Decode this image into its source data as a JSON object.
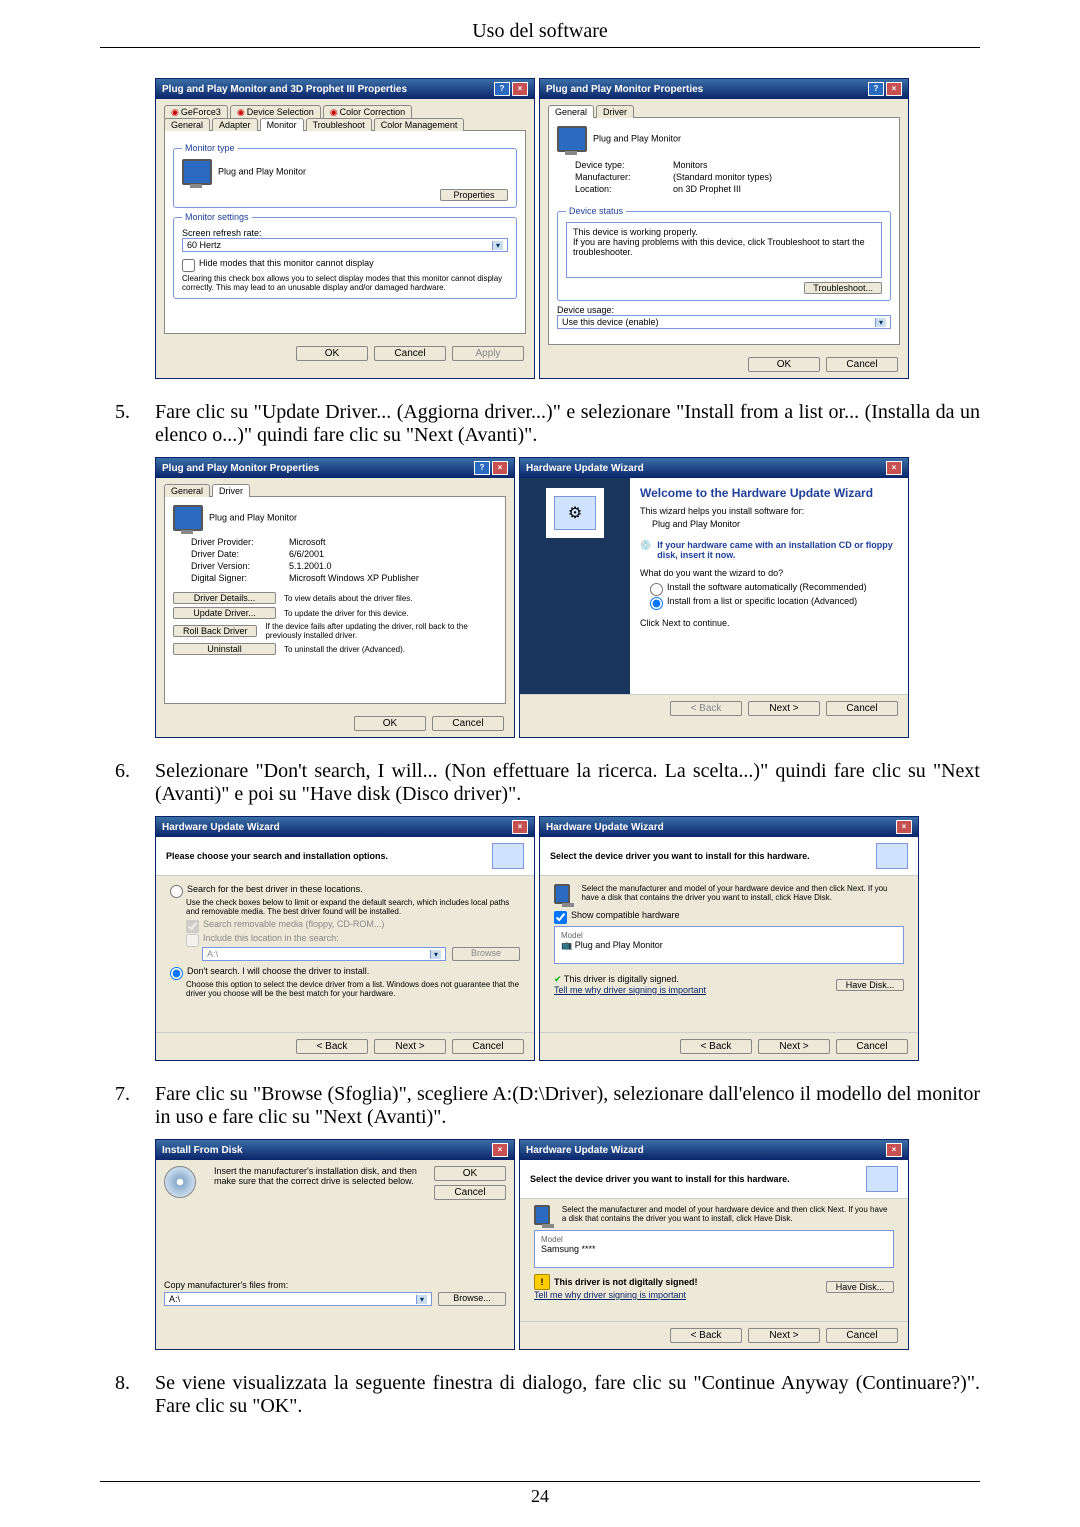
{
  "header": {
    "title": "Uso del software"
  },
  "steps": {
    "s5": {
      "num": "5.",
      "text": "Fare clic su \"Update Driver... (Aggiorna driver...)\" e selezionare \"Install from a list or... (Installa da un elenco o...)\" quindi fare clic su \"Next (Avanti)\"."
    },
    "s6": {
      "num": "6.",
      "text": "Selezionare \"Don't search, I will... (Non effettuare la ricerca. La scelta...)\" quindi fare clic su \"Next (Avanti)\" e poi su \"Have disk (Disco driver)\"."
    },
    "s7": {
      "num": "7.",
      "text": "Fare clic su \"Browse (Sfoglia)\", scegliere A:(D:\\Driver), selezionare dall'elenco il modello del monitor in uso e fare clic su \"Next (Avanti)\"."
    },
    "s8": {
      "num": "8.",
      "text": "Se viene visualizzata la seguente finestra di dialogo, fare clic su \"Continue Anyway (Continuare?)\". Fare clic su \"OK\"."
    }
  },
  "dlg1a": {
    "title": "Plug and Play Monitor and 3D Prophet III Properties",
    "tabs": {
      "geforce": "GeForce3",
      "device": "Device Selection",
      "color": "Color Correction",
      "general": "General",
      "adapter": "Adapter",
      "monitor": "Monitor",
      "trouble": "Troubleshoot",
      "mgmt": "Color Management"
    },
    "monitor_type_legend": "Monitor type",
    "monitor_name": "Plug and Play Monitor",
    "properties_btn": "Properties",
    "settings_legend": "Monitor settings",
    "refresh_label": "Screen refresh rate:",
    "refresh_value": "60 Hertz",
    "hide_chk": "Hide modes that this monitor cannot display",
    "hide_desc": "Clearing this check box allows you to select display modes that this monitor cannot display correctly. This may lead to an unusable display and/or damaged hardware.",
    "ok": "OK",
    "cancel": "Cancel",
    "apply": "Apply"
  },
  "dlg1b": {
    "title": "Plug and Play Monitor Properties",
    "tab_general": "General",
    "tab_driver": "Driver",
    "monitor_name": "Plug and Play Monitor",
    "device_type_k": "Device type:",
    "device_type_v": "Monitors",
    "manufacturer_k": "Manufacturer:",
    "manufacturer_v": "(Standard monitor types)",
    "location_k": "Location:",
    "location_v": "on 3D Prophet III",
    "status_legend": "Device status",
    "status_text": "This device is working properly.\nIf you are having problems with this device, click Troubleshoot to start the troubleshooter.",
    "troubleshoot_btn": "Troubleshoot...",
    "usage_label": "Device usage:",
    "usage_value": "Use this device (enable)",
    "ok": "OK",
    "cancel": "Cancel"
  },
  "dlg2a": {
    "title": "Plug and Play Monitor Properties",
    "tab_general": "General",
    "tab_driver": "Driver",
    "monitor_name": "Plug and Play Monitor",
    "provider_k": "Driver Provider:",
    "provider_v": "Microsoft",
    "date_k": "Driver Date:",
    "date_v": "6/6/2001",
    "version_k": "Driver Version:",
    "version_v": "5.1.2001.0",
    "signer_k": "Digital Signer:",
    "signer_v": "Microsoft Windows XP Publisher",
    "details_btn": "Driver Details...",
    "details_txt": "To view details about the driver files.",
    "update_btn": "Update Driver...",
    "update_txt": "To update the driver for this device.",
    "roll_btn": "Roll Back Driver",
    "roll_txt": "If the device fails after updating the driver, roll back to the previously installed driver.",
    "uninstall_btn": "Uninstall",
    "uninstall_txt": "To uninstall the driver (Advanced).",
    "ok": "OK",
    "cancel": "Cancel"
  },
  "dlg2b": {
    "title": "Hardware Update Wizard",
    "welcome": "Welcome to the Hardware Update Wizard",
    "helps": "This wizard helps you install software for:",
    "device": "Plug and Play Monitor",
    "cd_hint": "If your hardware came with an installation CD or floppy disk, insert it now.",
    "what": "What do you want the wizard to do?",
    "opt_auto": "Install the software automatically (Recommended)",
    "opt_list": "Install from a list or specific location (Advanced)",
    "cont": "Click Next to continue.",
    "back": "< Back",
    "next": "Next >",
    "cancel": "Cancel"
  },
  "dlg3a": {
    "title": "Hardware Update Wizard",
    "header": "Please choose your search and installation options.",
    "search_opt": "Search for the best driver in these locations.",
    "search_desc": "Use the check boxes below to limit or expand the default search, which includes local paths and removable media. The best driver found will be installed.",
    "chk_media": "Search removable media (floppy, CD-ROM...)",
    "chk_include": "Include this location in the search:",
    "path": "A:\\",
    "browse": "Browse",
    "dont_opt": "Don't search. I will choose the driver to install.",
    "dont_desc": "Choose this option to select the device driver from a list. Windows does not guarantee that the driver you choose will be the best match for your hardware.",
    "back": "< Back",
    "next": "Next >",
    "cancel": "Cancel"
  },
  "dlg3b": {
    "title": "Hardware Update Wizard",
    "header": "Select the device driver you want to install for this hardware.",
    "desc": "Select the manufacturer and model of your hardware device and then click Next. If you have a disk that contains the driver you want to install, click Have Disk.",
    "show_compat": "Show compatible hardware",
    "model_label": "Model",
    "model_item": "Plug and Play Monitor",
    "signed": "This driver is digitally signed.",
    "tell": "Tell me why driver signing is important",
    "havedisk": "Have Disk...",
    "back": "< Back",
    "next": "Next >",
    "cancel": "Cancel"
  },
  "dlg4a": {
    "title": "Install From Disk",
    "instr": "Insert the manufacturer's installation disk, and then make sure that the correct drive is selected below.",
    "ok": "OK",
    "cancel": "Cancel",
    "copy_label": "Copy manufacturer's files from:",
    "path": "A:\\",
    "browse": "Browse..."
  },
  "dlg4b": {
    "title": "Hardware Update Wizard",
    "header": "Select the device driver you want to install for this hardware.",
    "desc": "Select the manufacturer and model of your hardware device and then click Next. If you have a disk that contains the driver you want to install, click Have Disk.",
    "model_label": "Model",
    "model_item": "Samsung ****",
    "not_signed": "This driver is not digitally signed!",
    "tell": "Tell me why driver signing is important",
    "havedisk": "Have Disk...",
    "back": "< Back",
    "next": "Next >",
    "cancel": "Cancel"
  },
  "footer": {
    "page_num": "24"
  }
}
